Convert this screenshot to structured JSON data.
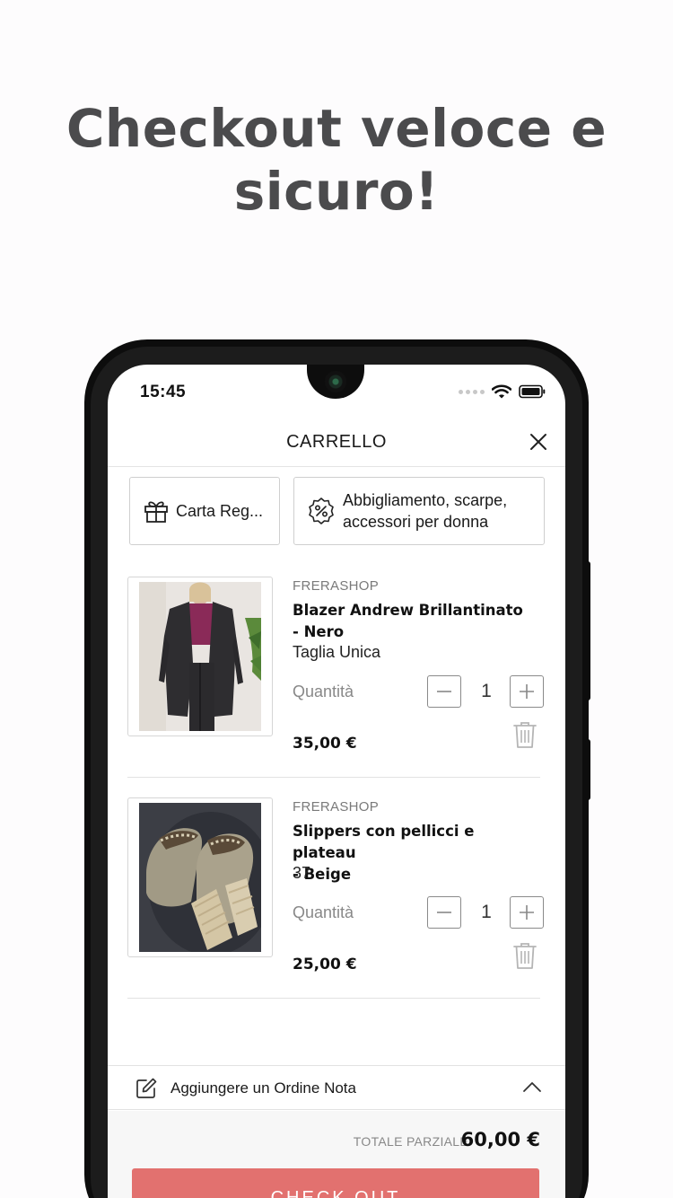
{
  "headline": {
    "line1": "Checkout veloce e",
    "line2": "sicuro!"
  },
  "status_bar": {
    "time": "15:45",
    "icons": [
      "signal-dots-icon",
      "wifi-icon",
      "battery-icon"
    ]
  },
  "header": {
    "title": "CARRELLO",
    "close_icon": "close-icon"
  },
  "chips": [
    {
      "label": "Carta Reg...",
      "icon": "gift-icon"
    },
    {
      "label_line1": "Abbigliamento, scarpe,",
      "label_line2": "accessori per donna",
      "icon": "discount-badge-icon"
    }
  ],
  "cart_items": [
    {
      "shop": "FRERASHOP",
      "name_line1": "Blazer Andrew Brillantinato",
      "name_line2": "- Nero",
      "variant": "Taglia Unica",
      "quantity_label": "Quantità",
      "quantity": "1",
      "price": "35,00 €"
    },
    {
      "shop": "FRERASHOP",
      "name_line1": "Slippers con pellicci e plateau",
      "name_line2": "- Beige",
      "variant": "37",
      "quantity_label": "Quantità",
      "quantity": "1",
      "price": "25,00 €"
    }
  ],
  "note": {
    "label": "Aggiungere un Ordine Nota",
    "icon": "edit-note-icon",
    "chevron": "chevron-up-icon"
  },
  "summary": {
    "subtotal_label": "TOTALE PARZIALE",
    "subtotal_value": "60,00 €",
    "checkout_label": "CHECK OUT"
  },
  "colors": {
    "accent": "#e2716f",
    "headline": "#4b4b4d"
  }
}
